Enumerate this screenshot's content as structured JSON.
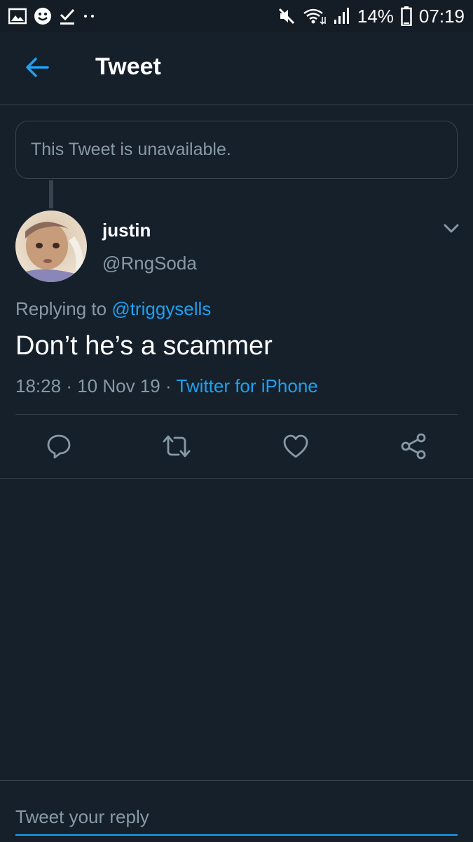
{
  "status_bar": {
    "left_icons": [
      "image-icon",
      "smiley-icon",
      "download-check-icon",
      "more-dots-icon"
    ],
    "battery_percent": "14%",
    "time": "07:19",
    "right_icons": [
      "mute-icon",
      "wifi-icon",
      "signal-icon",
      "battery-icon"
    ]
  },
  "header": {
    "back_icon": "arrow-left-icon",
    "title": "Tweet"
  },
  "parent_tweet": {
    "text": "This Tweet is unavailable."
  },
  "tweet": {
    "display_name": "justin",
    "handle": "@RngSoda",
    "replying_prefix": "Replying to",
    "replying_to": "@triggysells",
    "text": "Don’t he’s a scammer",
    "time": "18:28",
    "sep1": "·",
    "date": "10 Nov 19",
    "sep2": "·",
    "source": "Twitter for iPhone"
  },
  "actions": [
    "reply-icon",
    "retweet-icon",
    "like-icon",
    "share-icon"
  ],
  "reply_bar": {
    "placeholder": "Tweet your reply"
  },
  "colors": {
    "background": "#15202b",
    "accent": "#1da1f2",
    "secondary_text": "#8899a6",
    "border": "#38444d"
  }
}
